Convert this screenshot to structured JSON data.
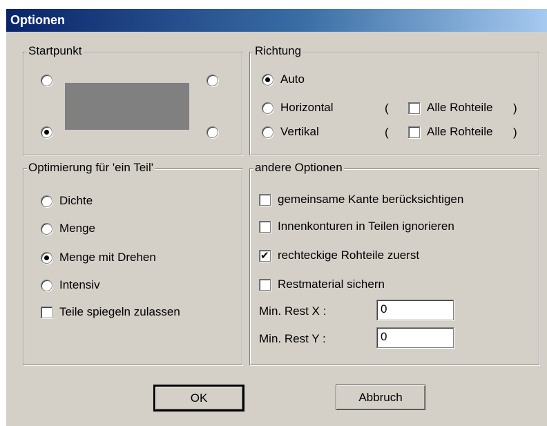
{
  "window": {
    "title": "Optionen"
  },
  "startpunkt": {
    "legend": "Startpunkt",
    "selected": "bottom-left"
  },
  "richtung": {
    "legend": "Richtung",
    "options": [
      "Auto",
      "Horizontal",
      "Vertikal"
    ],
    "selected": "Auto",
    "paren_open": "(",
    "paren_close": ")",
    "all_label": "Alle Rohteile",
    "horizontal_all_checked": false,
    "vertical_all_checked": false
  },
  "optimierung": {
    "legend": "Optimierung für 'ein Teil'",
    "options": [
      "Dichte",
      "Menge",
      "Menge mit Drehen",
      "Intensiv"
    ],
    "selected": "Menge mit Drehen",
    "mirror_label": "Teile spiegeln zulassen",
    "mirror_checked": false
  },
  "andere": {
    "legend": "andere Optionen",
    "checks": [
      {
        "label": "gemeinsame Kante berücksichtigen",
        "checked": false
      },
      {
        "label": "Innenkonturen in Teilen ignorieren",
        "checked": false
      },
      {
        "label": "rechteckige Rohteile zuerst",
        "checked": true
      },
      {
        "label": "Restmaterial sichern",
        "checked": false
      }
    ],
    "rest_x_label": "Min. Rest X :",
    "rest_x_value": "0",
    "rest_y_label": "Min. Rest Y :",
    "rest_y_value": "0"
  },
  "buttons": {
    "ok": "OK",
    "cancel": "Abbruch"
  }
}
